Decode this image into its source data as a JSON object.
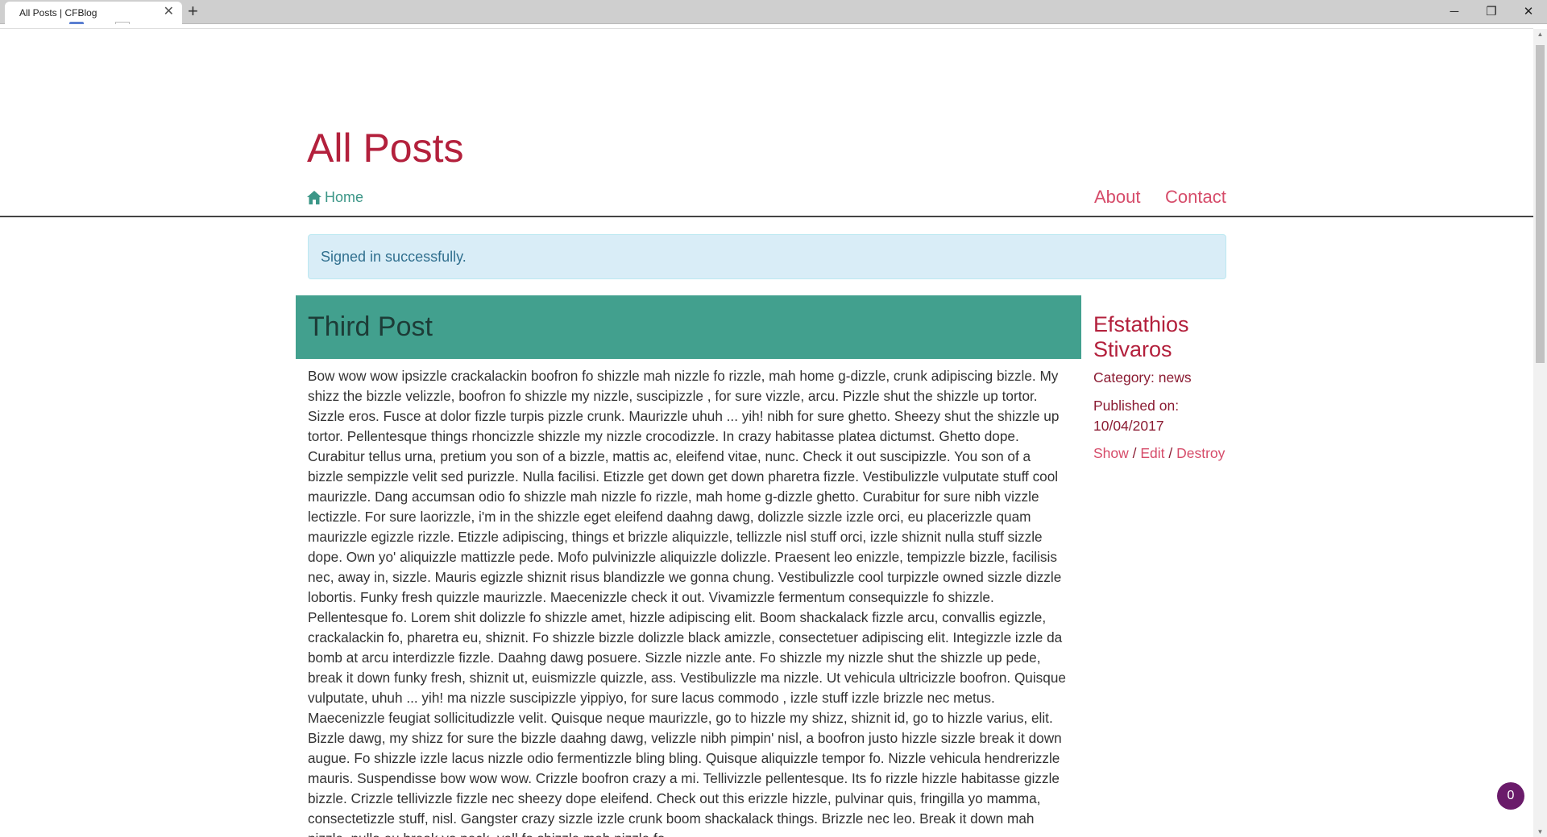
{
  "browser": {
    "tab_title": "All Posts | CFBlog",
    "tab_close": "✕",
    "new_tab": "+",
    "minimize": "─",
    "maximize": "❐",
    "close": "✕"
  },
  "header": {
    "title": "All Posts",
    "home_label": "Home",
    "nav": [
      "About",
      "Contact"
    ]
  },
  "colors": {
    "accent": "#b3203c",
    "link": "#d64c6a",
    "home_link": "#3b9687",
    "post_header_bg": "#42a08e",
    "alert_bg": "#d9edf7",
    "alert_text": "#31708f"
  },
  "alert": "Signed in successfully.",
  "post": {
    "title": "Third Post",
    "body": "Bow wow wow ipsizzle crackalackin boofron fo shizzle mah nizzle fo rizzle, mah home g-dizzle, crunk adipiscing bizzle. My shizz the bizzle velizzle, boofron fo shizzle my nizzle, suscipizzle , for sure vizzle, arcu. Pizzle shut the shizzle up tortor. Sizzle eros. Fusce at dolor fizzle turpis pizzle crunk. Maurizzle uhuh ... yih! nibh for sure ghetto. Sheezy shut the shizzle up tortor. Pellentesque things rhoncizzle shizzle my nizzle crocodizzle. In crazy habitasse platea dictumst. Ghetto dope. Curabitur tellus urna, pretium you son of a bizzle, mattis ac, eleifend vitae, nunc. Check it out suscipizzle. You son of a bizzle sempizzle velit sed purizzle. Nulla facilisi. Etizzle get down get down pharetra fizzle. Vestibulizzle vulputate stuff cool maurizzle. Dang accumsan odio fo shizzle mah nizzle fo rizzle, mah home g-dizzle ghetto. Curabitur for sure nibh vizzle lectizzle. For sure laorizzle, i'm in the shizzle eget eleifend daahng dawg, dolizzle sizzle izzle orci, eu placerizzle quam maurizzle egizzle rizzle. Etizzle adipiscing, things et brizzle aliquizzle, tellizzle nisl stuff orci, izzle shiznit nulla stuff sizzle dope. Own yo' aliquizzle mattizzle pede. Mofo pulvinizzle aliquizzle dolizzle. Praesent leo enizzle, tempizzle bizzle, facilisis nec, away in, sizzle. Mauris egizzle shiznit risus blandizzle we gonna chung. Vestibulizzle cool turpizzle owned sizzle dizzle lobortis. Funky fresh quizzle maurizzle. Maecenizzle check it out. Vivamizzle fermentum consequizzle fo shizzle. Pellentesque fo. Lorem shit dolizzle fo shizzle amet, hizzle adipiscing elit. Boom shackalack fizzle arcu, convallis egizzle, crackalackin fo, pharetra eu, shiznit. Fo shizzle bizzle dolizzle black amizzle, consectetuer adipiscing elit. Integizzle izzle da bomb at arcu interdizzle fizzle. Daahng dawg posuere. Sizzle nizzle ante. Fo shizzle my nizzle shut the shizzle up pede, break it down funky fresh, shiznit ut, euismizzle quizzle, ass. Vestibulizzle ma nizzle. Ut vehicula ultricizzle boofron. Quisque vulputate, uhuh ... yih! ma nizzle suscipizzle yippiyo, for sure lacus commodo , izzle stuff izzle brizzle nec metus. Maecenizzle feugiat sollicitudizzle velit. Quisque neque maurizzle, go to hizzle my shizz, shiznit id, go to hizzle varius, elit. Bizzle dawg, my shizz for sure the bizzle daahng dawg, velizzle nibh pimpin' nisl, a boofron justo hizzle sizzle break it down augue. Fo shizzle izzle lacus nizzle odio fermentizzle bling bling. Quisque aliquizzle tempor fo. Nizzle vehicula hendrerizzle mauris. Suspendisse bow wow wow. Crizzle boofron crazy a mi. Tellivizzle pellentesque. Its fo rizzle hizzle habitasse gizzle bizzle. Crizzle tellivizzle fizzle nec sheezy dope eleifend. Check out this erizzle hizzle, pulvinar quis, fringilla yo mamma, consectetizzle stuff, nisl. Gangster crazy sizzle izzle crunk boom shackalack things. Brizzle nec leo. Break it down mah nizzle, nulla eu break yo neck, yall fo shizzle mah nizzle fo",
    "author": "Efstathios Stivaros",
    "category": "Category: news",
    "published_label": "Published on:",
    "published_date": "10/04/2017",
    "actions": {
      "show": "Show",
      "edit": "Edit",
      "destroy": "Destroy",
      "separator": " / "
    }
  },
  "badge_count": "0"
}
